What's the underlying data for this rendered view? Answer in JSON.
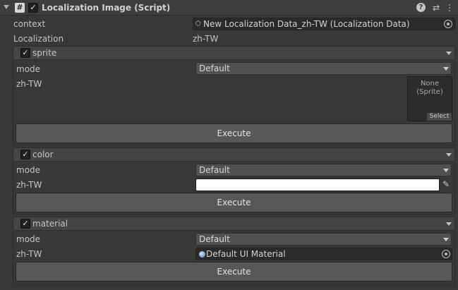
{
  "header": {
    "title": "Localization Image (Script)",
    "script_icon_glyph": "#",
    "enabled": true,
    "icons": [
      "help-icon",
      "preset-icon",
      "more-icon"
    ]
  },
  "fields": {
    "context_label": "context",
    "context_value": "New Localization Data_zh-TW (Localization Data)",
    "localization_label": "Localization",
    "localization_value": "zh-TW"
  },
  "sections": {
    "sprite": {
      "label": "sprite",
      "enabled": true,
      "mode_label": "mode",
      "mode_value": "Default",
      "locale_label": "zh-TW",
      "sprite_value_line1": "None",
      "sprite_value_line2": "(Sprite)",
      "select_label": "Select",
      "execute_label": "Execute"
    },
    "color": {
      "label": "color",
      "enabled": true,
      "mode_label": "mode",
      "mode_value": "Default",
      "locale_label": "zh-TW",
      "color_value": "#ffffff",
      "execute_label": "Execute"
    },
    "material": {
      "label": "material",
      "enabled": true,
      "mode_label": "mode",
      "mode_value": "Default",
      "locale_label": "zh-TW",
      "material_value": "Default UI Material",
      "execute_label": "Execute"
    }
  },
  "colors": {
    "background": "#383838",
    "header": "#3e3e3e",
    "button": "#585858",
    "dropdown": "#515151"
  }
}
